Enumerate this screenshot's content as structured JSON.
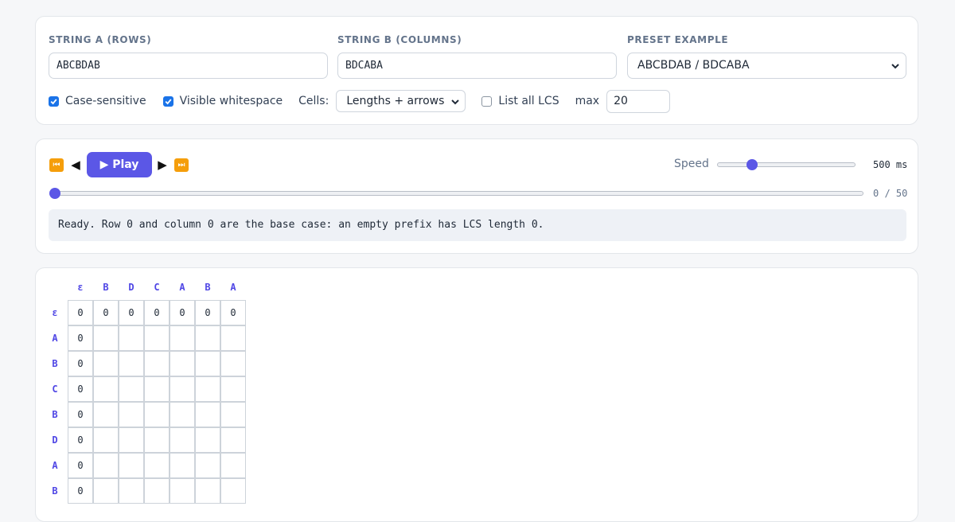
{
  "inputs": {
    "string_a_label": "STRING A (ROWS)",
    "string_a_value": "ABCBDAB",
    "string_b_label": "STRING B (COLUMNS)",
    "string_b_value": "BDCABA",
    "preset_label": "PRESET EXAMPLE",
    "preset_value": "ABCBDAB / BDCABA"
  },
  "options": {
    "case_sensitive_label": "Case-sensitive",
    "case_sensitive_checked": true,
    "visible_whitespace_label": "Visible whitespace",
    "visible_whitespace_checked": true,
    "cells_label": "Cells:",
    "cells_value": "Lengths + arrows",
    "list_all_lcs_label": "List all LCS",
    "list_all_lcs_checked": false,
    "max_label": "max",
    "max_value": "20"
  },
  "player": {
    "first_icon": "⏮",
    "prev_icon": "◀",
    "play_label": "▶ Play",
    "next_icon": "▶",
    "last_icon": "⏭",
    "speed_label": "Speed",
    "speed_value_text": "500 ms",
    "speed_fraction": 0.25,
    "step_text": "0 / 50",
    "step_current": 0,
    "step_total": 50,
    "status_text": "Ready. Row 0 and column 0 are the base case: an empty prefix has LCS length 0."
  },
  "table": {
    "empty_symbol": "ε",
    "col_headers": [
      "B",
      "D",
      "C",
      "A",
      "B",
      "A"
    ],
    "row_headers": [
      "A",
      "B",
      "C",
      "B",
      "D",
      "A",
      "B"
    ],
    "base_value": "0"
  },
  "colors": {
    "accent": "#5b57e6",
    "header_text": "#4f46e5",
    "checkbox": "#1a73e8",
    "icon_orange": "#f59e0b"
  }
}
